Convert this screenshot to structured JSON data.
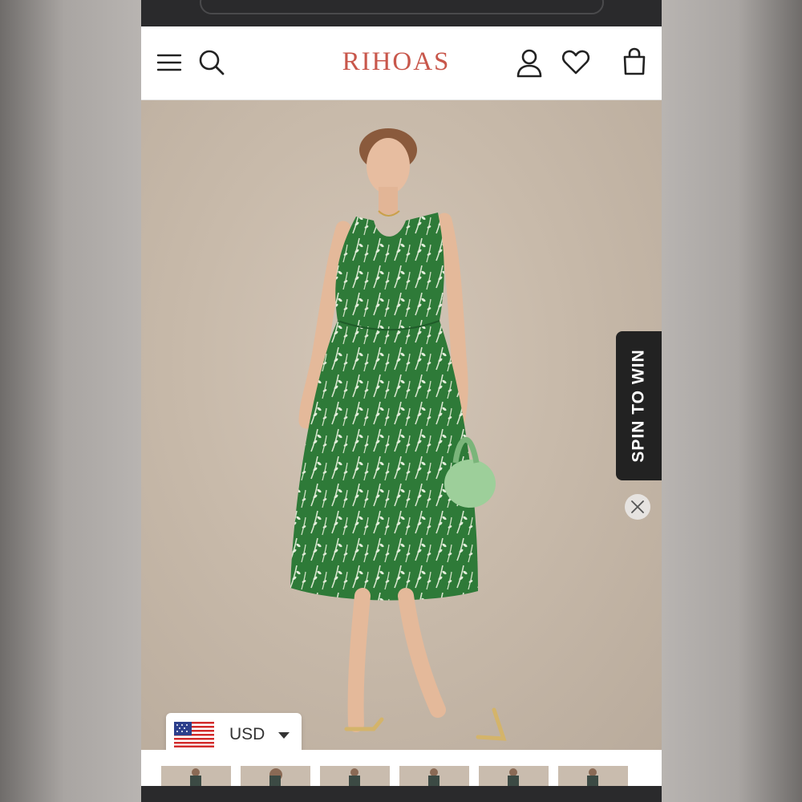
{
  "header": {
    "brand": "RIHOAS",
    "icons": [
      "menu-icon",
      "search-icon",
      "account-icon",
      "wishlist-heart-icon",
      "shopping-bag-icon"
    ]
  },
  "promo": {
    "spin_label": "SPIN TO WIN"
  },
  "currency": {
    "code": "USD",
    "flag": "us-flag-icon"
  },
  "colors": {
    "brand": "#c8574b",
    "dress_green": "#2f7a3a",
    "spin_bg": "#222222"
  },
  "gallery": {
    "thumbnail_count": 6
  }
}
